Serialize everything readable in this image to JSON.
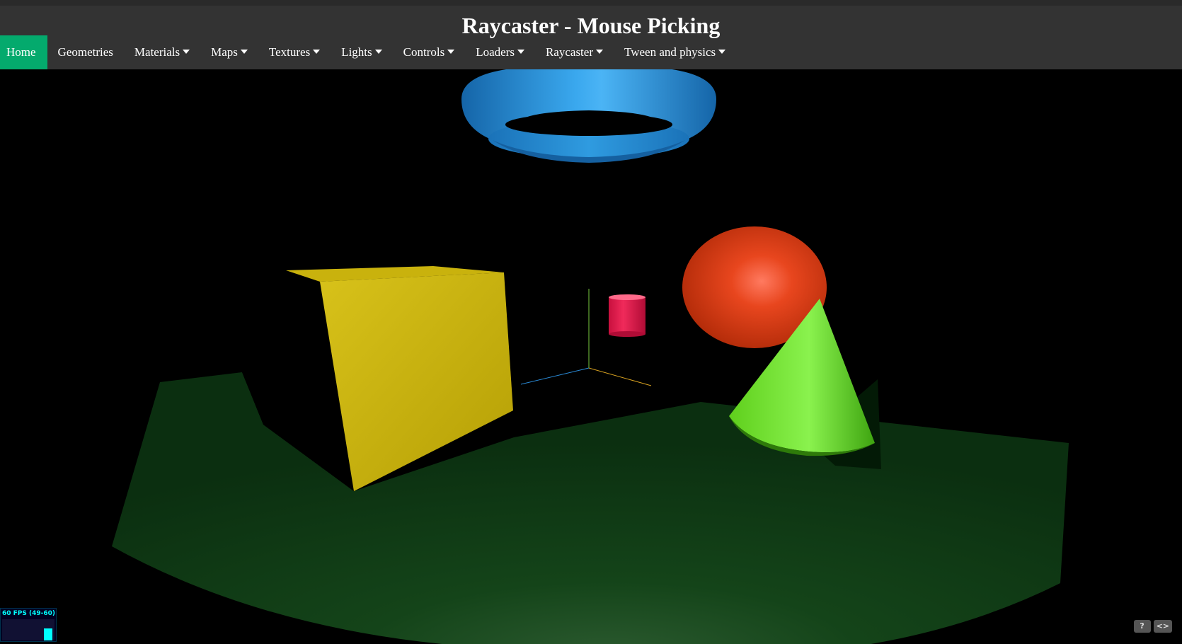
{
  "page": {
    "title": "Raycaster - Mouse Picking"
  },
  "nav": {
    "items": [
      {
        "label": "Home",
        "active": true,
        "dropdown": false
      },
      {
        "label": "Geometries",
        "active": false,
        "dropdown": false
      },
      {
        "label": "Materials",
        "active": false,
        "dropdown": true
      },
      {
        "label": "Maps",
        "active": false,
        "dropdown": true
      },
      {
        "label": "Textures",
        "active": false,
        "dropdown": true
      },
      {
        "label": "Lights",
        "active": false,
        "dropdown": true
      },
      {
        "label": "Controls",
        "active": false,
        "dropdown": true
      },
      {
        "label": "Loaders",
        "active": false,
        "dropdown": true
      },
      {
        "label": "Raycaster",
        "active": false,
        "dropdown": true
      },
      {
        "label": "Tween and physics",
        "active": false,
        "dropdown": true
      }
    ]
  },
  "scene": {
    "objects": [
      "torus",
      "box",
      "cylinder",
      "sphere",
      "cone",
      "ground-plane",
      "axes-helper"
    ],
    "colors": {
      "torus": "#1f8fd6",
      "box": "#d4bd12",
      "cylinder": "#e0194a",
      "sphere": "#e0421a",
      "cone": "#6ee02a",
      "ground": "#0f3a14",
      "header": "#333333",
      "active_nav": "#04aa6d"
    }
  },
  "stats": {
    "fps_text": "60 FPS (49-60)"
  },
  "corner": {
    "help_label": "?",
    "code_label": "<>"
  }
}
